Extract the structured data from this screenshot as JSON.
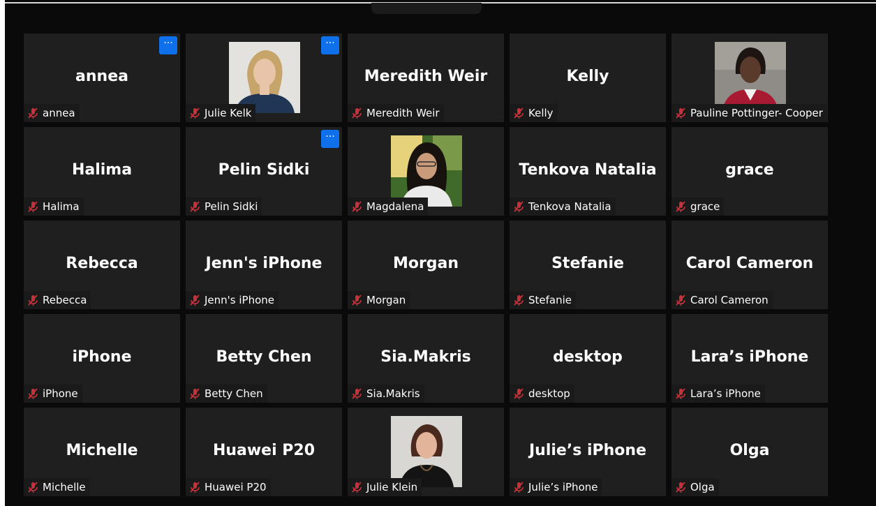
{
  "meeting": {
    "view": "gallery",
    "accent_color": "#0e71eb",
    "mute_color": "#c4323a",
    "participants": [
      {
        "display_name": "annea",
        "label": "annea",
        "muted": true,
        "has_video": false,
        "more_button": "···"
      },
      {
        "display_name": "",
        "label": "Julie Kelk",
        "muted": true,
        "has_video": true,
        "more_button": "···"
      },
      {
        "display_name": "Meredith Weir",
        "label": "Meredith Weir",
        "muted": true,
        "has_video": false
      },
      {
        "display_name": "Kelly",
        "label": "Kelly",
        "muted": true,
        "has_video": false
      },
      {
        "display_name": "",
        "label": "Pauline Pottinger- Cooper",
        "muted": true,
        "has_video": true
      },
      {
        "display_name": "Halima",
        "label": "Halima",
        "muted": true,
        "has_video": false
      },
      {
        "display_name": "Pelin Sidki",
        "label": "Pelin Sidki",
        "muted": true,
        "has_video": false,
        "more_button": "···"
      },
      {
        "display_name": "",
        "label": "Magdalena",
        "muted": true,
        "has_video": true
      },
      {
        "display_name": "Tenkova Natalia",
        "label": "Tenkova Natalia",
        "muted": true,
        "has_video": false
      },
      {
        "display_name": "grace",
        "label": "grace",
        "muted": true,
        "has_video": false
      },
      {
        "display_name": "Rebecca",
        "label": "Rebecca",
        "muted": true,
        "has_video": false
      },
      {
        "display_name": "Jenn's iPhone",
        "label": "Jenn's iPhone",
        "muted": true,
        "has_video": false
      },
      {
        "display_name": "Morgan",
        "label": "Morgan",
        "muted": true,
        "has_video": false
      },
      {
        "display_name": "Stefanie",
        "label": "Stefanie",
        "muted": true,
        "has_video": false
      },
      {
        "display_name": "Carol Cameron",
        "label": "Carol Cameron",
        "muted": true,
        "has_video": false
      },
      {
        "display_name": "iPhone",
        "label": "iPhone",
        "muted": true,
        "has_video": false
      },
      {
        "display_name": "Betty Chen",
        "label": "Betty Chen",
        "muted": true,
        "has_video": false
      },
      {
        "display_name": "Sia.Makris",
        "label": "Sia.Makris",
        "muted": true,
        "has_video": false
      },
      {
        "display_name": "desktop",
        "label": "desktop",
        "muted": true,
        "has_video": false
      },
      {
        "display_name": "Lara’s iPhone",
        "label": "Lara’s iPhone",
        "muted": true,
        "has_video": false
      },
      {
        "display_name": "Michelle",
        "label": "Michelle",
        "muted": true,
        "has_video": false
      },
      {
        "display_name": "Huawei P20",
        "label": "Huawei P20",
        "muted": true,
        "has_video": false
      },
      {
        "display_name": "",
        "label": "Julie Klein",
        "muted": true,
        "has_video": true
      },
      {
        "display_name": "Julie’s iPhone",
        "label": "Julie’s iPhone",
        "muted": true,
        "has_video": false
      },
      {
        "display_name": "Olga",
        "label": "Olga",
        "muted": true,
        "has_video": false
      }
    ]
  }
}
